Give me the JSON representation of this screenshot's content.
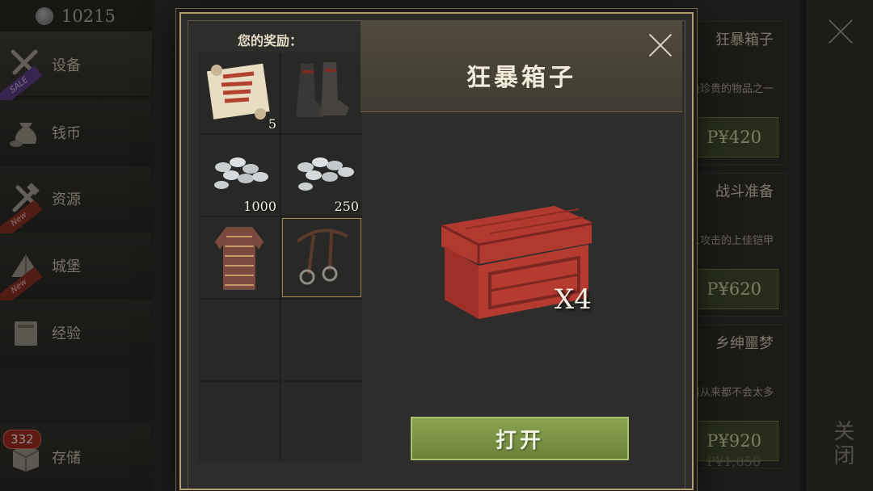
{
  "sidebar": {
    "currency_value": "10215",
    "items": [
      {
        "label": "设备",
        "icon": "crossed-weapons-icon",
        "ribbon": "SALE"
      },
      {
        "label": "钱币",
        "icon": "money-bag-icon",
        "ribbon": ""
      },
      {
        "label": "资源",
        "icon": "hammer-tools-icon",
        "ribbon": "New"
      },
      {
        "label": "城堡",
        "icon": "tent-icon",
        "ribbon": "New"
      },
      {
        "label": "经验",
        "icon": "book-icon",
        "ribbon": ""
      },
      {
        "label": "存储",
        "icon": "box-icon",
        "ribbon": ""
      }
    ],
    "storage_badge": "332"
  },
  "background_cards": [
    {
      "title": "狂暴箱子",
      "desc": "最珍贵的物品之一",
      "price": "P¥420",
      "old_price": ""
    },
    {
      "title": "战斗准备",
      "desc": "对抗任何敌人攻击的上佳铠甲",
      "price": "P¥620",
      "old_price": ""
    },
    {
      "title": "乡绅噩梦",
      "desc": "这样的武器从来都不会太多",
      "price": "P¥920",
      "old_price": "P¥1,850"
    }
  ],
  "close_column": {
    "label": "关闭"
  },
  "modal": {
    "rewards_label": "您的奖励：",
    "title": "狂暴箱子",
    "chest_count": "X4",
    "open_button": "打开",
    "rewards": [
      {
        "item": "scroll-icon",
        "qty": "5"
      },
      {
        "item": "boots-icon",
        "qty": ""
      },
      {
        "item": "silver-coins-icon",
        "qty": "1000"
      },
      {
        "item": "silver-coins-icon",
        "qty": "250"
      },
      {
        "item": "gambeson-armor-icon",
        "qty": ""
      },
      {
        "item": "bridle-icon",
        "qty": ""
      },
      {
        "item": "",
        "qty": ""
      },
      {
        "item": "",
        "qty": ""
      },
      {
        "item": "",
        "qty": ""
      },
      {
        "item": "",
        "qty": ""
      }
    ]
  }
}
